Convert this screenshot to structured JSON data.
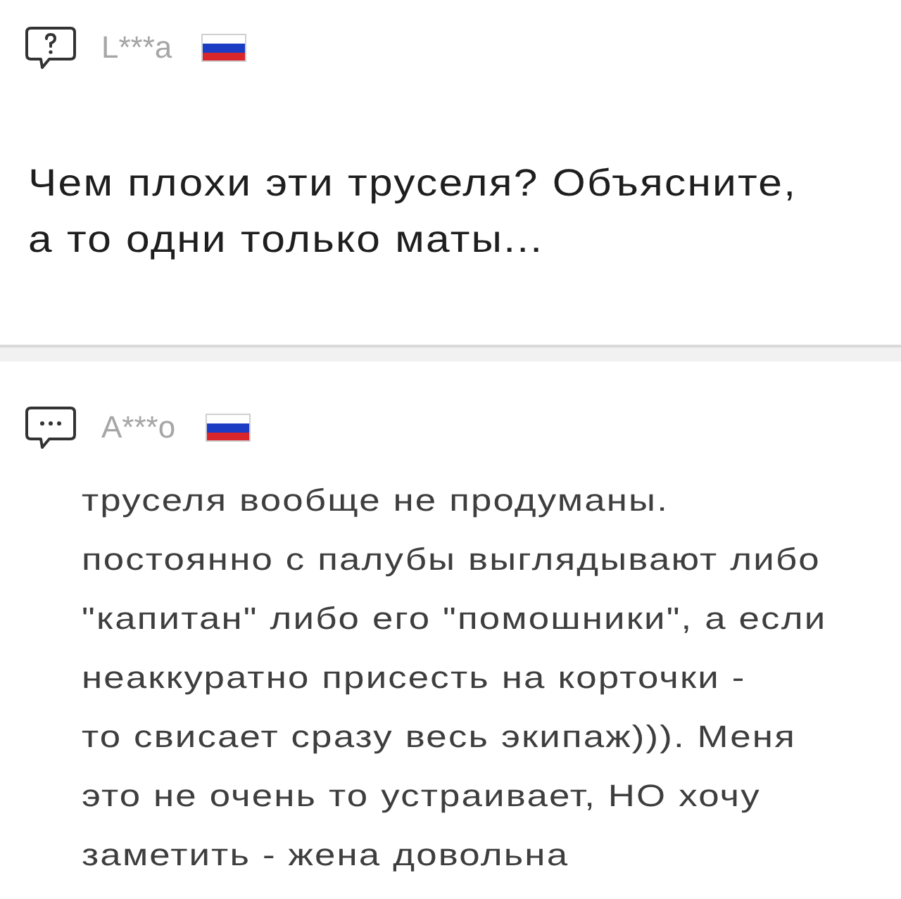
{
  "posts": [
    {
      "kind": "question",
      "author": "L***a",
      "lines": [
        "Чем плохи эти труселя? Объясните,",
        "а то одни только маты..."
      ]
    },
    {
      "kind": "answer",
      "author": "A***o",
      "lines": [
        "труселя вообще не продуманы.",
        "постоянно с палубы выглядывают либо",
        "\"капитан\" либо его \"помошники\", а если",
        "неаккуратно присесть на корточки -",
        "то свисает сразу весь экипаж))). Меня",
        "это не очень то устраивает, НО хочу",
        "заметить - жена довольна"
      ]
    }
  ]
}
